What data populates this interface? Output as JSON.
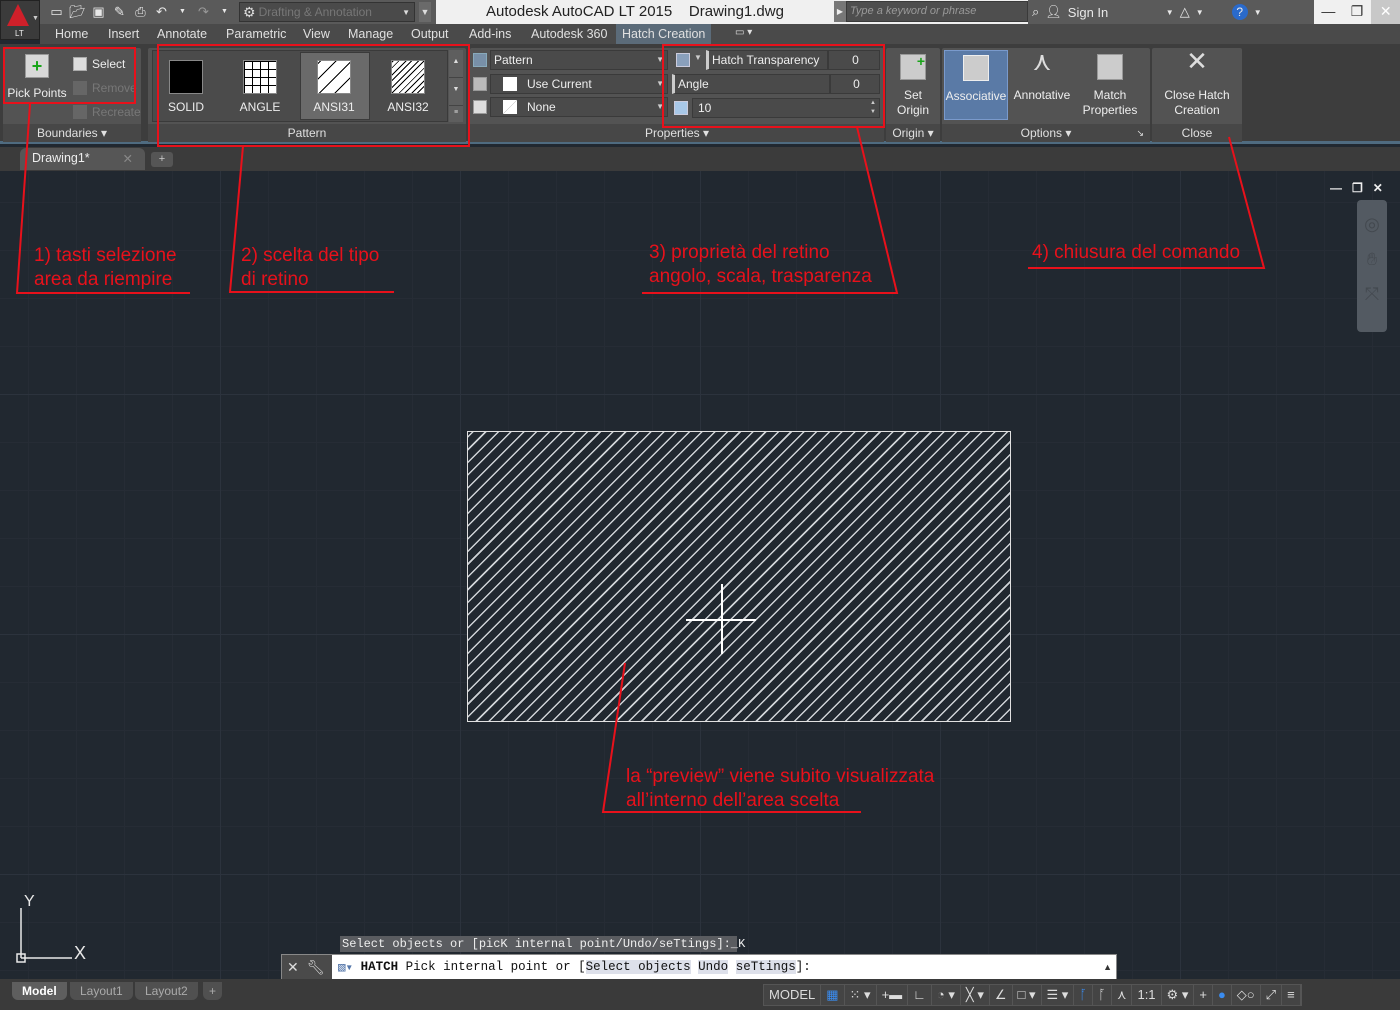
{
  "app": {
    "title": "Autodesk AutoCAD LT 2015",
    "document": "Drawing1.dwg",
    "logo_badge": "LT"
  },
  "quick_access": {
    "workspace": "Drafting & Annotation",
    "icons": [
      "new-icon",
      "open-icon",
      "save-icon",
      "save-as-icon",
      "plot-icon",
      "undo-icon",
      "redo-icon"
    ]
  },
  "search": {
    "placeholder": "Type a keyword or phrase"
  },
  "infocenter": {
    "sign_in": "Sign In"
  },
  "ribbon_tabs": [
    "Home",
    "Insert",
    "Annotate",
    "Parametric",
    "View",
    "Manage",
    "Output",
    "Add-ins",
    "Autodesk 360",
    "Hatch Creation"
  ],
  "active_tab": "Hatch Creation",
  "boundaries": {
    "pick_points": "Pick Points",
    "select": "Select",
    "remove": "Remove",
    "recreate": "Recreate",
    "label": "Boundaries"
  },
  "pattern": {
    "items": [
      "SOLID",
      "ANGLE",
      "ANSI31",
      "ANSI32"
    ],
    "selected": "ANSI31",
    "label": "Pattern"
  },
  "properties": {
    "type": "Pattern",
    "color": "Use Current",
    "background": "None",
    "transparency_label": "Hatch Transparency",
    "transparency_value": "0",
    "angle_label": "Angle",
    "angle_value": "0",
    "scale_value": "10",
    "label": "Properties"
  },
  "origin": {
    "set_origin": "Set Origin",
    "label": "Origin"
  },
  "options": {
    "associative": "Associative",
    "annotative": "Annotative",
    "match_properties": "Match Properties",
    "label": "Options"
  },
  "close": {
    "button": "Close Hatch Creation",
    "label": "Close"
  },
  "file_tabs": {
    "active": "Drawing1*"
  },
  "annotations": {
    "a1": "1) tasti selezione\narea da riempire",
    "a2": "2) scelta del tipo\ndi retino",
    "a3": "3) proprietà del retino\nangolo, scala, trasparenza",
    "a4": "4) chiusura del comando",
    "a5": "la “preview” viene subito visualizzata\nall’interno dell’area scelta"
  },
  "ucs": {
    "x": "X",
    "y": "Y"
  },
  "command": {
    "history": "Select objects or [picK internal point/Undo/seTtings]:_K",
    "prompt_cmd": "HATCH",
    "prompt_text": " Pick internal point or [",
    "options": [
      "Select objects",
      "Undo",
      "seTtings"
    ],
    "prompt_end": "]:"
  },
  "layout_tabs": [
    "Model",
    "Layout1",
    "Layout2"
  ],
  "status": {
    "model": "MODEL",
    "scale": "1:1"
  },
  "colors": {
    "accent_red": "#e8111b",
    "canvas": "#212830",
    "associative_active": "#5a7aa6"
  }
}
